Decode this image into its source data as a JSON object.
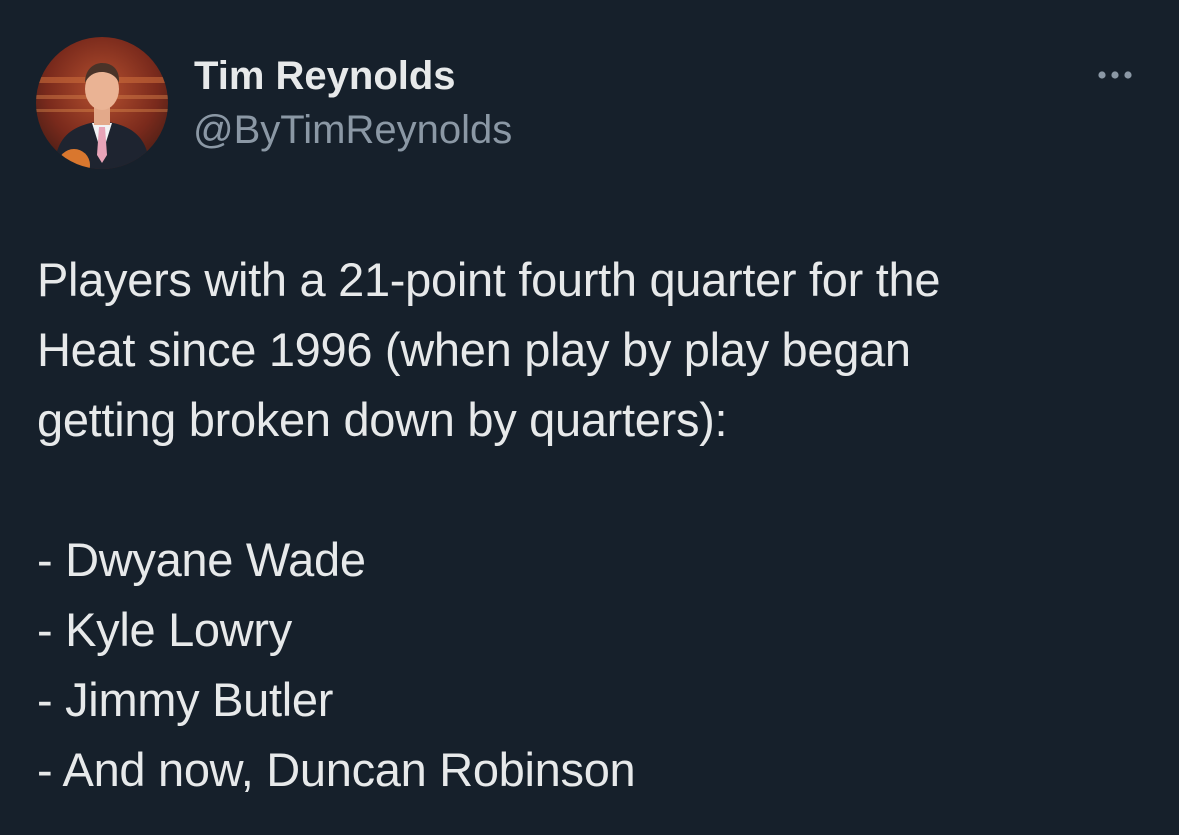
{
  "author": {
    "display_name": "Tim Reynolds",
    "handle": "@ByTimReynolds",
    "avatar_icon": "profile-photo"
  },
  "more_icon": "ellipsis-icon",
  "tweet": {
    "intro_lines": [
      "Players with a 21-point fourth quarter for the",
      "Heat since 1996 (when play by play began",
      "getting broken down by quarters):"
    ],
    "list_items": [
      "- Dwyane Wade",
      "- Kyle Lowry",
      "- Jimmy Butler",
      "- And now, Duncan Robinson"
    ]
  },
  "colors": {
    "background": "#16202b",
    "primary_text": "#e7e9ea",
    "secondary_text": "#8b98a5"
  }
}
